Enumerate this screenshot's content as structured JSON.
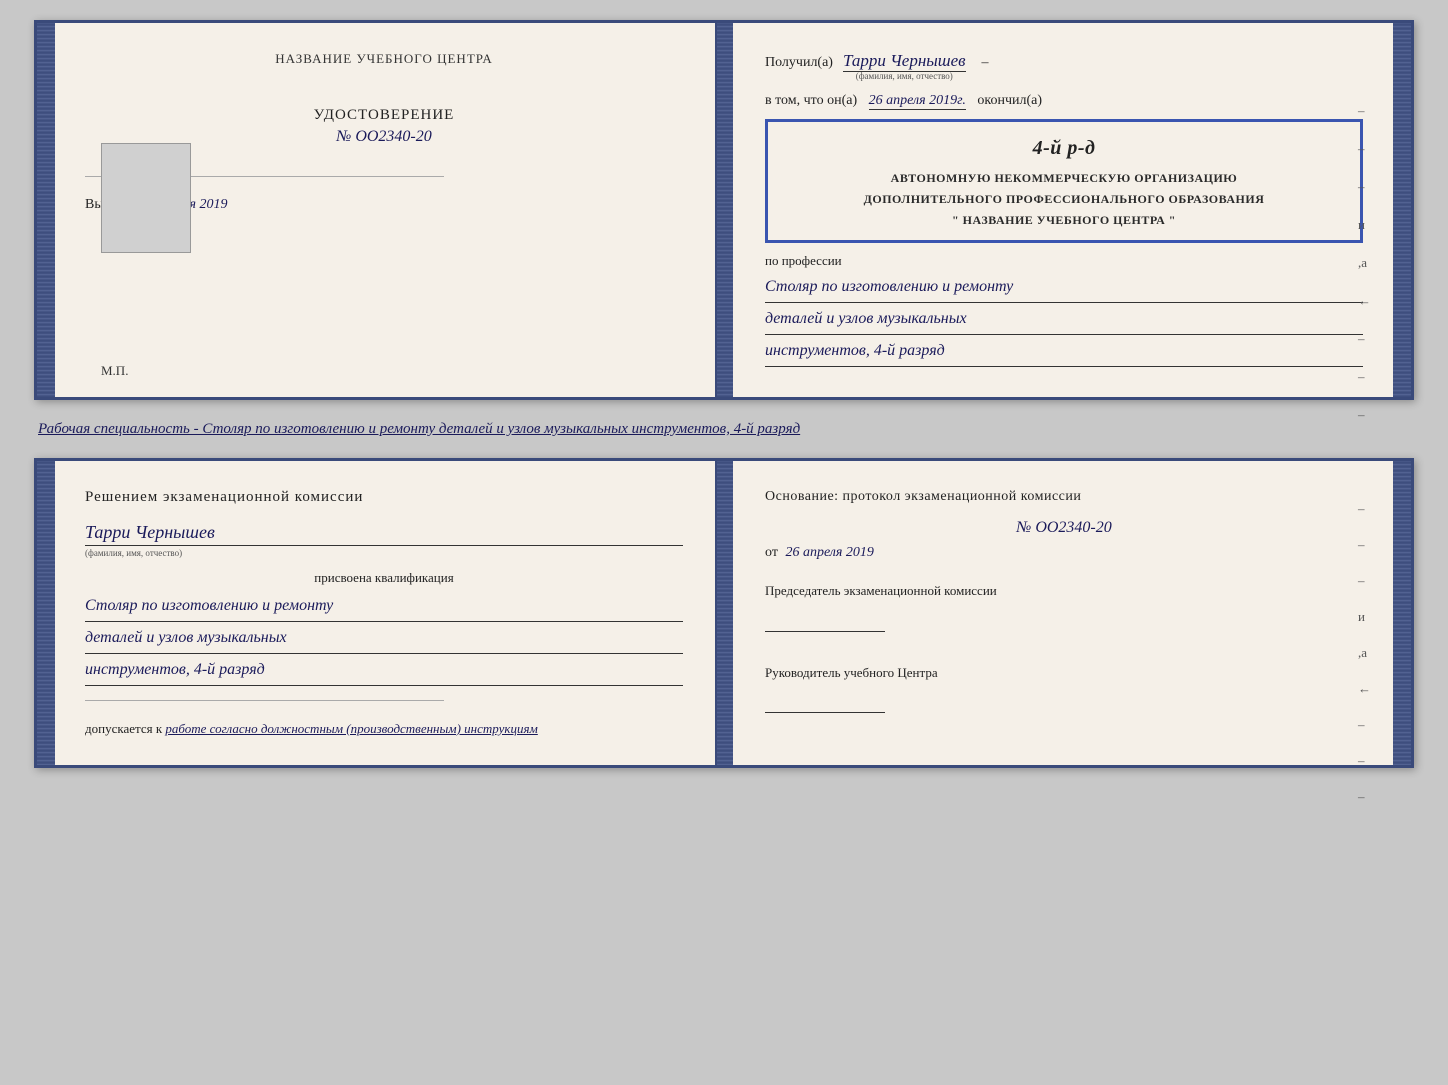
{
  "top_doc": {
    "left": {
      "header": "НАЗВАНИЕ УЧЕБНОГО ЦЕНТРА",
      "udost_label": "УДОСТОВЕРЕНИЕ",
      "udost_number": "№ OO2340-20",
      "vydano_label": "Выдано",
      "vydano_date": "26 апреля 2019",
      "mp_label": "М.П."
    },
    "right": {
      "poluchil_label": "Получил(а)",
      "recipient_name": "Тарри Чернышев",
      "fio_hint": "(фамилия, имя, отчество)",
      "dash": "–",
      "vtom_label": "в том, что он(а)",
      "date_value": "26 апреля 2019г.",
      "okonchil_label": "окончил(а)",
      "stamp_large": "4-й р-д",
      "stamp_line1": "АВТОНОМНУЮ НЕКОММЕРЧЕСКУЮ ОРГАНИЗАЦИЮ",
      "stamp_line2": "ДОПОЛНИТЕЛЬНОГО ПРОФЕССИОНАЛЬНОГО ОБРАЗОВАНИЯ",
      "stamp_line3": "\" НАЗВАНИЕ УЧЕБНОГО ЦЕНТРА \"",
      "po_professii": "по профессии",
      "profession_line1": "Столяр по изготовлению и ремонту",
      "profession_line2": "деталей и узлов музыкальных",
      "profession_line3": "инструментов, 4-й разряд",
      "dashes": [
        "–",
        "–",
        "–",
        "и",
        ",а",
        "←",
        "–",
        "–",
        "–"
      ]
    }
  },
  "subtitle": "Рабочая специальность - Столяр по изготовлению и ремонту деталей и узлов музыкальных инструментов, 4-й разряд",
  "bottom_doc": {
    "left": {
      "resheniem_label": "Решением экзаменационной комиссии",
      "name": "Тарри Чернышев",
      "fio_hint": "(фамилия, имя, отчество)",
      "prisvoena_label": "присвоена квалификация",
      "profession_line1": "Столяр по изготовлению и ремонту",
      "profession_line2": "деталей и узлов музыкальных",
      "profession_line3": "инструментов, 4-й разряд",
      "dopusk_label": "допускается к",
      "dopusk_text": "работе согласно должностным (производственным) инструкциям"
    },
    "right": {
      "osnovanie_label": "Основание: протокол экзаменационной комиссии",
      "nomer": "№ OO2340-20",
      "ot_label": "от",
      "ot_date": "26 апреля 2019",
      "predsedatel_label": "Председатель экзаменационной комиссии",
      "rukovoditel_label": "Руководитель учебного Центра",
      "dashes": [
        "–",
        "–",
        "–",
        "и",
        ",а",
        "←",
        "–",
        "–",
        "–"
      ]
    }
  }
}
